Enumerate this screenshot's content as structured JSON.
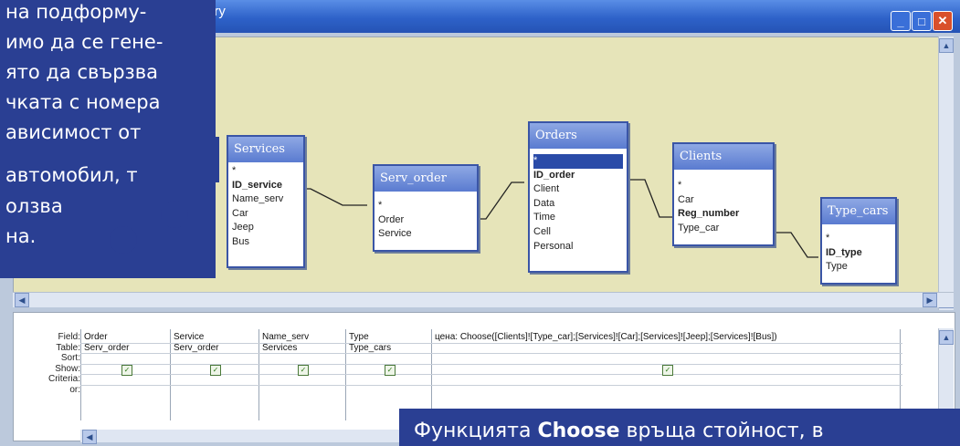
{
  "window": {
    "title": "ery"
  },
  "tables": {
    "services": {
      "name": "Services",
      "fields": [
        "*",
        "ID_service",
        "Name_serv",
        "Car",
        "Jeep",
        "Bus"
      ],
      "key": "ID_service"
    },
    "serv_order": {
      "name": "Serv_order",
      "fields": [
        "*",
        "Order",
        "Service"
      ]
    },
    "orders": {
      "name": "Orders",
      "fields": [
        "*",
        "ID_order",
        "Client",
        "Data",
        "Time",
        "Cell",
        "Personal"
      ],
      "key": "ID_order"
    },
    "clients": {
      "name": "Clients",
      "fields": [
        "*",
        "Car",
        "Reg_number",
        "Type_car"
      ],
      "key": "Reg_number"
    },
    "type_cars": {
      "name": "Type_cars",
      "fields": [
        "*",
        "ID_type",
        "Type"
      ],
      "key": "ID_type"
    }
  },
  "grid": {
    "row_labels": [
      "Field:",
      "Table:",
      "Sort:",
      "Show:",
      "Criteria:",
      "or:"
    ],
    "columns": [
      {
        "field": "Order",
        "table": "Serv_order",
        "show": true
      },
      {
        "field": "Service",
        "table": "Serv_order",
        "show": true
      },
      {
        "field": "Name_serv",
        "table": "Services",
        "show": true
      },
      {
        "field": "Type",
        "table": "Type_cars",
        "show": true
      },
      {
        "field": "цена: Choose([Clients]![Type_car];[Services]![Car];[Services]![Jeep];[Services]![Bus])",
        "table": "",
        "show": true
      }
    ]
  },
  "callout": {
    "lines": [
      "на подформу-",
      "имо да се гене-",
      "ято да свързва",
      "чката с номера",
      "ависимост от",
      " автомобил, то",
      "олзва",
      "на."
    ]
  },
  "bottom_callout": {
    "text_before": "Функцията ",
    "text_bold": "Choose",
    "text_after": " връща стойност, в"
  },
  "colors": {
    "diagram_bg": "#e6e4b9",
    "callout_bg": "#2a3f93",
    "table_header": "#5a7bd0",
    "titlebar": "#2e62c9"
  }
}
